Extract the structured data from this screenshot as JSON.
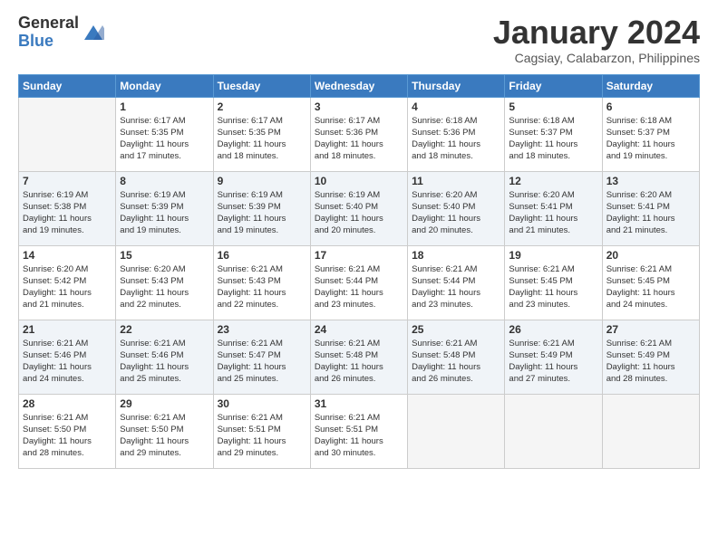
{
  "logo": {
    "general": "General",
    "blue": "Blue"
  },
  "title": "January 2024",
  "subtitle": "Cagsiay, Calabarzon, Philippines",
  "headers": [
    "Sunday",
    "Monday",
    "Tuesday",
    "Wednesday",
    "Thursday",
    "Friday",
    "Saturday"
  ],
  "weeks": [
    [
      {
        "day": "",
        "lines": []
      },
      {
        "day": "1",
        "lines": [
          "Sunrise: 6:17 AM",
          "Sunset: 5:35 PM",
          "Daylight: 11 hours",
          "and 17 minutes."
        ]
      },
      {
        "day": "2",
        "lines": [
          "Sunrise: 6:17 AM",
          "Sunset: 5:35 PM",
          "Daylight: 11 hours",
          "and 18 minutes."
        ]
      },
      {
        "day": "3",
        "lines": [
          "Sunrise: 6:17 AM",
          "Sunset: 5:36 PM",
          "Daylight: 11 hours",
          "and 18 minutes."
        ]
      },
      {
        "day": "4",
        "lines": [
          "Sunrise: 6:18 AM",
          "Sunset: 5:36 PM",
          "Daylight: 11 hours",
          "and 18 minutes."
        ]
      },
      {
        "day": "5",
        "lines": [
          "Sunrise: 6:18 AM",
          "Sunset: 5:37 PM",
          "Daylight: 11 hours",
          "and 18 minutes."
        ]
      },
      {
        "day": "6",
        "lines": [
          "Sunrise: 6:18 AM",
          "Sunset: 5:37 PM",
          "Daylight: 11 hours",
          "and 19 minutes."
        ]
      }
    ],
    [
      {
        "day": "7",
        "lines": [
          "Sunrise: 6:19 AM",
          "Sunset: 5:38 PM",
          "Daylight: 11 hours",
          "and 19 minutes."
        ]
      },
      {
        "day": "8",
        "lines": [
          "Sunrise: 6:19 AM",
          "Sunset: 5:39 PM",
          "Daylight: 11 hours",
          "and 19 minutes."
        ]
      },
      {
        "day": "9",
        "lines": [
          "Sunrise: 6:19 AM",
          "Sunset: 5:39 PM",
          "Daylight: 11 hours",
          "and 19 minutes."
        ]
      },
      {
        "day": "10",
        "lines": [
          "Sunrise: 6:19 AM",
          "Sunset: 5:40 PM",
          "Daylight: 11 hours",
          "and 20 minutes."
        ]
      },
      {
        "day": "11",
        "lines": [
          "Sunrise: 6:20 AM",
          "Sunset: 5:40 PM",
          "Daylight: 11 hours",
          "and 20 minutes."
        ]
      },
      {
        "day": "12",
        "lines": [
          "Sunrise: 6:20 AM",
          "Sunset: 5:41 PM",
          "Daylight: 11 hours",
          "and 21 minutes."
        ]
      },
      {
        "day": "13",
        "lines": [
          "Sunrise: 6:20 AM",
          "Sunset: 5:41 PM",
          "Daylight: 11 hours",
          "and 21 minutes."
        ]
      }
    ],
    [
      {
        "day": "14",
        "lines": [
          "Sunrise: 6:20 AM",
          "Sunset: 5:42 PM",
          "Daylight: 11 hours",
          "and 21 minutes."
        ]
      },
      {
        "day": "15",
        "lines": [
          "Sunrise: 6:20 AM",
          "Sunset: 5:43 PM",
          "Daylight: 11 hours",
          "and 22 minutes."
        ]
      },
      {
        "day": "16",
        "lines": [
          "Sunrise: 6:21 AM",
          "Sunset: 5:43 PM",
          "Daylight: 11 hours",
          "and 22 minutes."
        ]
      },
      {
        "day": "17",
        "lines": [
          "Sunrise: 6:21 AM",
          "Sunset: 5:44 PM",
          "Daylight: 11 hours",
          "and 23 minutes."
        ]
      },
      {
        "day": "18",
        "lines": [
          "Sunrise: 6:21 AM",
          "Sunset: 5:44 PM",
          "Daylight: 11 hours",
          "and 23 minutes."
        ]
      },
      {
        "day": "19",
        "lines": [
          "Sunrise: 6:21 AM",
          "Sunset: 5:45 PM",
          "Daylight: 11 hours",
          "and 23 minutes."
        ]
      },
      {
        "day": "20",
        "lines": [
          "Sunrise: 6:21 AM",
          "Sunset: 5:45 PM",
          "Daylight: 11 hours",
          "and 24 minutes."
        ]
      }
    ],
    [
      {
        "day": "21",
        "lines": [
          "Sunrise: 6:21 AM",
          "Sunset: 5:46 PM",
          "Daylight: 11 hours",
          "and 24 minutes."
        ]
      },
      {
        "day": "22",
        "lines": [
          "Sunrise: 6:21 AM",
          "Sunset: 5:46 PM",
          "Daylight: 11 hours",
          "and 25 minutes."
        ]
      },
      {
        "day": "23",
        "lines": [
          "Sunrise: 6:21 AM",
          "Sunset: 5:47 PM",
          "Daylight: 11 hours",
          "and 25 minutes."
        ]
      },
      {
        "day": "24",
        "lines": [
          "Sunrise: 6:21 AM",
          "Sunset: 5:48 PM",
          "Daylight: 11 hours",
          "and 26 minutes."
        ]
      },
      {
        "day": "25",
        "lines": [
          "Sunrise: 6:21 AM",
          "Sunset: 5:48 PM",
          "Daylight: 11 hours",
          "and 26 minutes."
        ]
      },
      {
        "day": "26",
        "lines": [
          "Sunrise: 6:21 AM",
          "Sunset: 5:49 PM",
          "Daylight: 11 hours",
          "and 27 minutes."
        ]
      },
      {
        "day": "27",
        "lines": [
          "Sunrise: 6:21 AM",
          "Sunset: 5:49 PM",
          "Daylight: 11 hours",
          "and 28 minutes."
        ]
      }
    ],
    [
      {
        "day": "28",
        "lines": [
          "Sunrise: 6:21 AM",
          "Sunset: 5:50 PM",
          "Daylight: 11 hours",
          "and 28 minutes."
        ]
      },
      {
        "day": "29",
        "lines": [
          "Sunrise: 6:21 AM",
          "Sunset: 5:50 PM",
          "Daylight: 11 hours",
          "and 29 minutes."
        ]
      },
      {
        "day": "30",
        "lines": [
          "Sunrise: 6:21 AM",
          "Sunset: 5:51 PM",
          "Daylight: 11 hours",
          "and 29 minutes."
        ]
      },
      {
        "day": "31",
        "lines": [
          "Sunrise: 6:21 AM",
          "Sunset: 5:51 PM",
          "Daylight: 11 hours",
          "and 30 minutes."
        ]
      },
      {
        "day": "",
        "lines": []
      },
      {
        "day": "",
        "lines": []
      },
      {
        "day": "",
        "lines": []
      }
    ]
  ]
}
